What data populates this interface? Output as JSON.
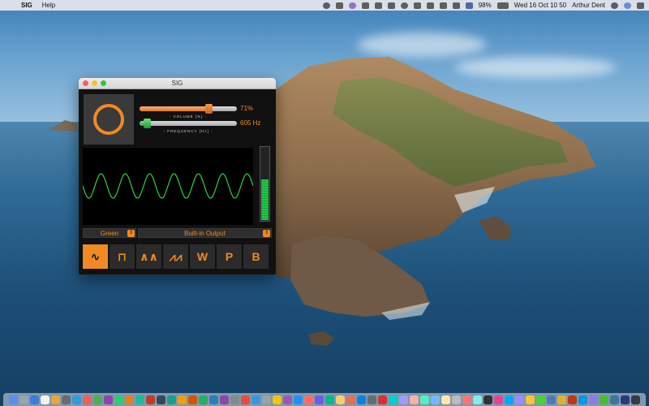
{
  "menubar": {
    "app_name": "SIG",
    "help_label": "Help",
    "battery": "98%",
    "datetime": "Wed 16 Oct  10 50",
    "user": "Arthur Dent"
  },
  "window": {
    "title": "SIG",
    "volume": {
      "value_text": "71%",
      "caption": "- VOLUME [%] -",
      "level": 0.71
    },
    "frequency": {
      "value_text": "605 Hz",
      "caption": "- FREQUENCY [Hz] -",
      "level": 0.08
    },
    "meter_level": 0.55,
    "trace_color_select": "Green",
    "output_select": "Built-in Output",
    "waveform_buttons": [
      {
        "label": "∿",
        "name": "sine",
        "active": true
      },
      {
        "label": "⊓",
        "name": "square",
        "active": false
      },
      {
        "label": "∧∧",
        "name": "triangle",
        "active": false
      },
      {
        "label": "⩘⩘",
        "name": "sawtooth",
        "active": false
      },
      {
        "label": "W",
        "name": "white-noise",
        "active": false
      },
      {
        "label": "P",
        "name": "pink-noise",
        "active": false
      },
      {
        "label": "B",
        "name": "brown-noise",
        "active": false
      }
    ]
  },
  "colors": {
    "accent": "#f08a24",
    "trace": "#2fd24a"
  }
}
